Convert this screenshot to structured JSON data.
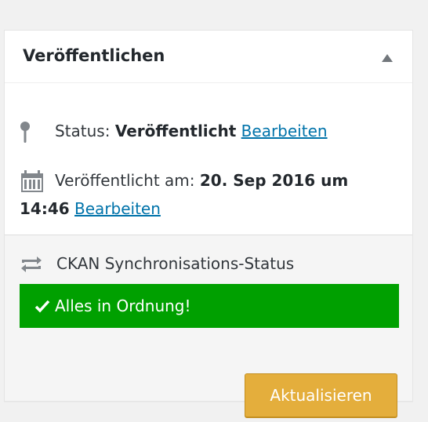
{
  "publish_box": {
    "title": "Veröffentlichen",
    "status": {
      "label": "Status:",
      "value": "Veröffentlicht",
      "edit_link": "Bearbeiten"
    },
    "published_on": {
      "label": "Veröffentlicht am:",
      "value": "20. Sep 2016 um 14:46",
      "edit_link": "Bearbeiten"
    }
  },
  "ckan_sync": {
    "label": "CKAN Synchronisations-Status",
    "status_message": "Alles in Ordnung!",
    "update_button": "Aktualisieren"
  },
  "colors": {
    "link": "#0073aa",
    "success": "#00a000",
    "button": "#e4ae3c"
  },
  "icons": [
    "pin-icon",
    "calendar-icon",
    "sync-icon",
    "check-icon",
    "toggle-arrow-icon"
  ]
}
